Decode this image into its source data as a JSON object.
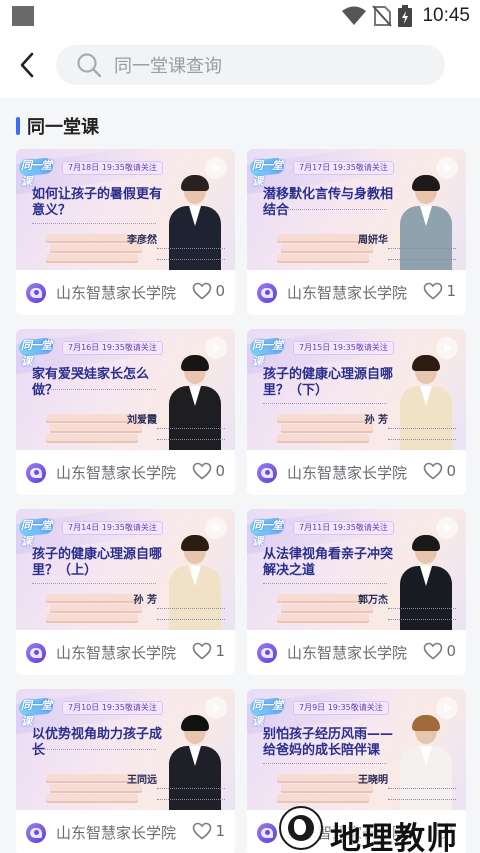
{
  "status_bar": {
    "time": "10:45"
  },
  "search": {
    "placeholder": "同一堂课查询"
  },
  "section": {
    "title": "同一堂课"
  },
  "colors": {
    "accent": "#3b6cf6",
    "banner_title": "#2a2f8f",
    "org_icon": "#6c4ce0"
  },
  "cards": [
    {
      "date_tag": "7月18日 19:35敬请关注",
      "title": "如何让孩子的暑假更有意义？",
      "speaker": "李彦然",
      "org": "山东智慧家长学院",
      "likes": "0"
    },
    {
      "date_tag": "7月17日 19:35敬请关注",
      "title": "潜移默化言传与身教相结合",
      "speaker": "周妍华",
      "org": "山东智慧家长学院",
      "likes": "1"
    },
    {
      "date_tag": "7月16日 19:35敬请关注",
      "title": "家有爱哭娃家长怎么做？",
      "speaker": "刘爱霞",
      "org": "山东智慧家长学院",
      "likes": "0"
    },
    {
      "date_tag": "7月15日 19:35敬请关注",
      "title": "孩子的健康心理源自哪里？（下）",
      "speaker": "孙 芳",
      "org": "山东智慧家长学院",
      "likes": "0"
    },
    {
      "date_tag": "7月14日 19:35敬请关注",
      "title": "孩子的健康心理源自哪里？（上）",
      "speaker": "孙 芳",
      "org": "山东智慧家长学院",
      "likes": "1"
    },
    {
      "date_tag": "7月11日 19:35敬请关注",
      "title": "从法律视角看亲子冲突解决之道",
      "speaker": "郭万杰",
      "org": "山东智慧家长学院",
      "likes": "0"
    },
    {
      "date_tag": "7月10日 19:35敬请关注",
      "title": "以优势视角助力孩子成长",
      "speaker": "王同远",
      "org": "山东智慧家长学院",
      "likes": "1"
    },
    {
      "date_tag": "7月9日 19:35敬请关注",
      "title": "别怕孩子经历风雨——给爸妈的成长陪伴课",
      "speaker": "王晓明",
      "org": "山东智慧家长学院",
      "likes": ""
    }
  ],
  "watermark": {
    "text": "地理教师"
  },
  "icons": {
    "back": "chevron-left-icon",
    "search": "search-icon",
    "like": "heart-icon",
    "play": "play-icon"
  }
}
